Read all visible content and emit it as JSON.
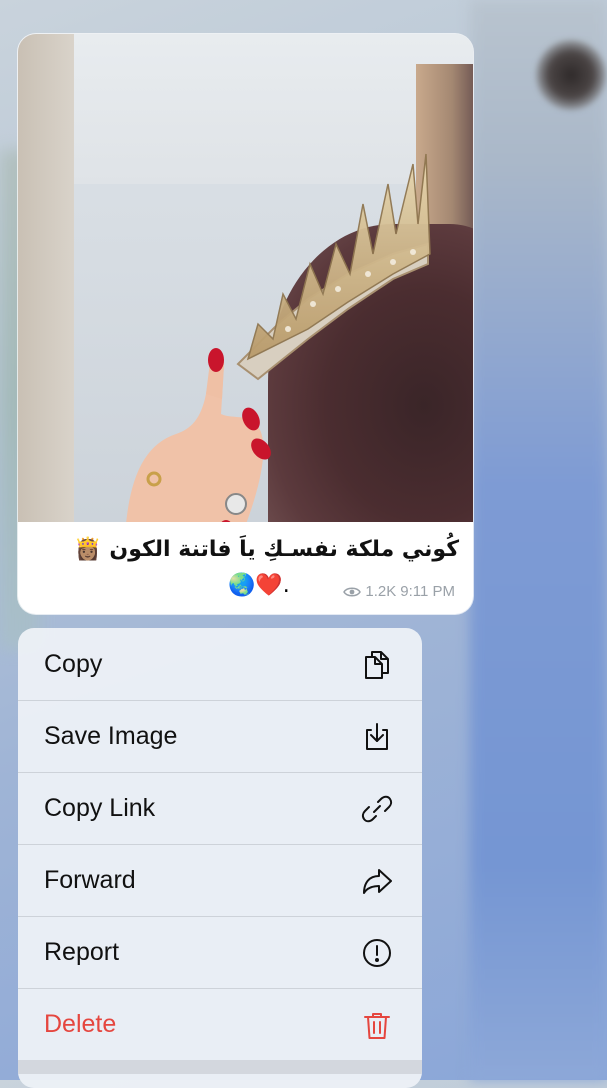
{
  "message": {
    "caption_line1": "كُوني ملكة نفسـكِ ياَ فاتنة الكون 👸🏽",
    "caption_line2": "🌏❤️.",
    "views": "1.2K",
    "time": "9:11 PM"
  },
  "context_menu": {
    "items": [
      {
        "label": "Copy",
        "icon": "copy-icon"
      },
      {
        "label": "Save Image",
        "icon": "save-image-icon"
      },
      {
        "label": "Copy Link",
        "icon": "link-icon"
      },
      {
        "label": "Forward",
        "icon": "forward-icon"
      },
      {
        "label": "Report",
        "icon": "report-icon"
      },
      {
        "label": "Delete",
        "icon": "trash-icon"
      }
    ]
  },
  "colors": {
    "delete": "#e5463f",
    "meta": "#9aa1a8"
  }
}
